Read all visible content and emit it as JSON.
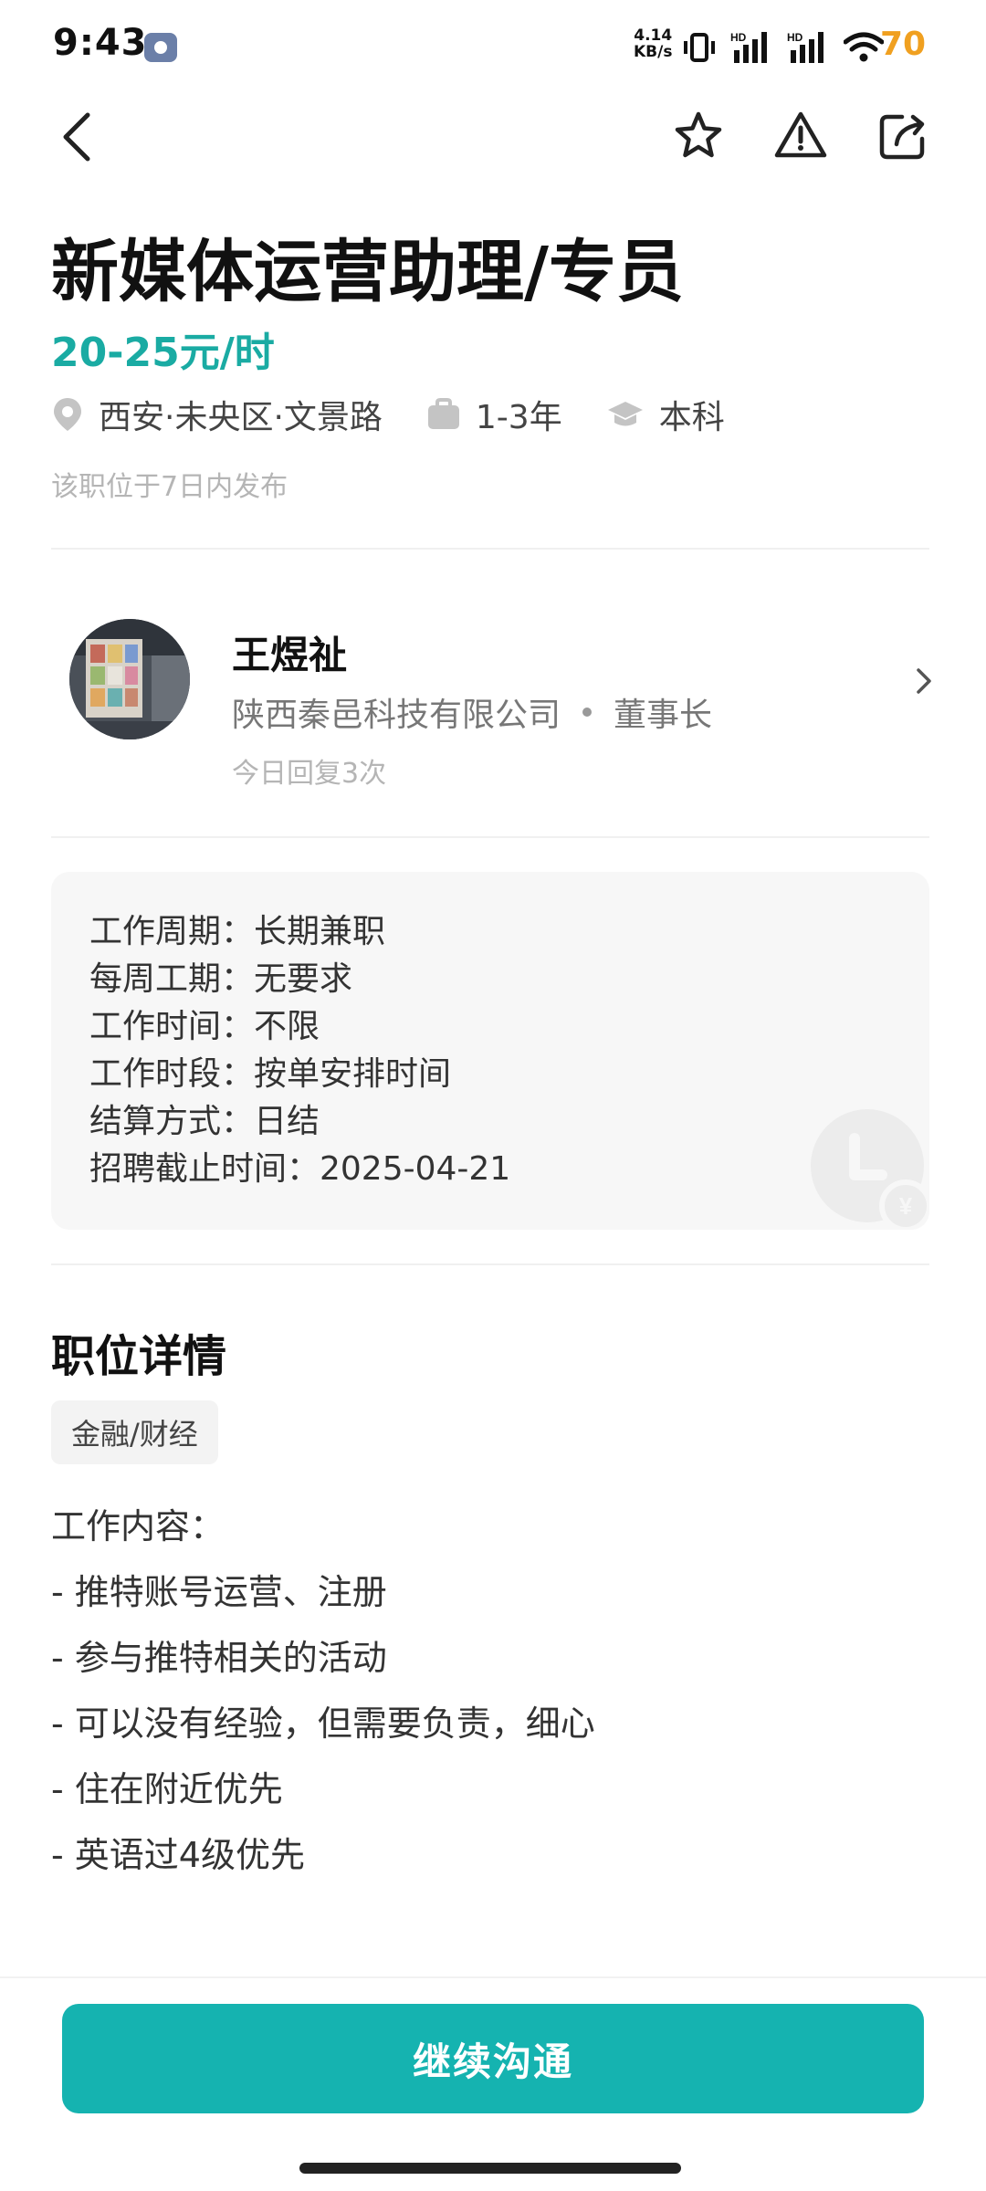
{
  "status_bar": {
    "time": "9:43",
    "net_speed_value": "4.14",
    "net_speed_unit": "KB/s",
    "battery": "70",
    "icons": [
      "vibrate-icon",
      "hd-signal-icon",
      "hd-signal-icon",
      "wifi-icon"
    ]
  },
  "nav": {
    "back_icon": "chevron-left-icon",
    "actions": [
      "star-icon",
      "warning-icon",
      "share-icon"
    ]
  },
  "job": {
    "title": "新媒体运营助理/专员",
    "salary": "20-25元/时",
    "location": "西安·未央区·文景路",
    "experience": "1-3年",
    "education": "本科",
    "posted": "该职位于7日内发布"
  },
  "recruiter": {
    "name": "王煜祉",
    "company": "陕西秦邑科技有限公司",
    "role": "董事长",
    "reply": "今日回复3次"
  },
  "info": {
    "lines": [
      "工作周期：长期兼职",
      "每周工期：无要求",
      "工作时间：不限",
      "工作时段：按单安排时间",
      "结算方式：日结",
      "招聘截止时间：2025-04-21"
    ],
    "watermark_icon": "clock-yen-icon"
  },
  "details": {
    "title": "职位详情",
    "tag": "金融/财经",
    "lines": [
      "工作内容：",
      "- 推特账号运营、注册",
      "- 参与推特相关的活动",
      "- 可以没有经验，但需要负责，细心",
      "- 住在附近优先",
      "- 英语过4级优先"
    ]
  },
  "cta": {
    "label": "继续沟通"
  },
  "colors": {
    "accent": "#15b3b0",
    "salary": "#1aaba3",
    "battery": "#f0a020"
  }
}
